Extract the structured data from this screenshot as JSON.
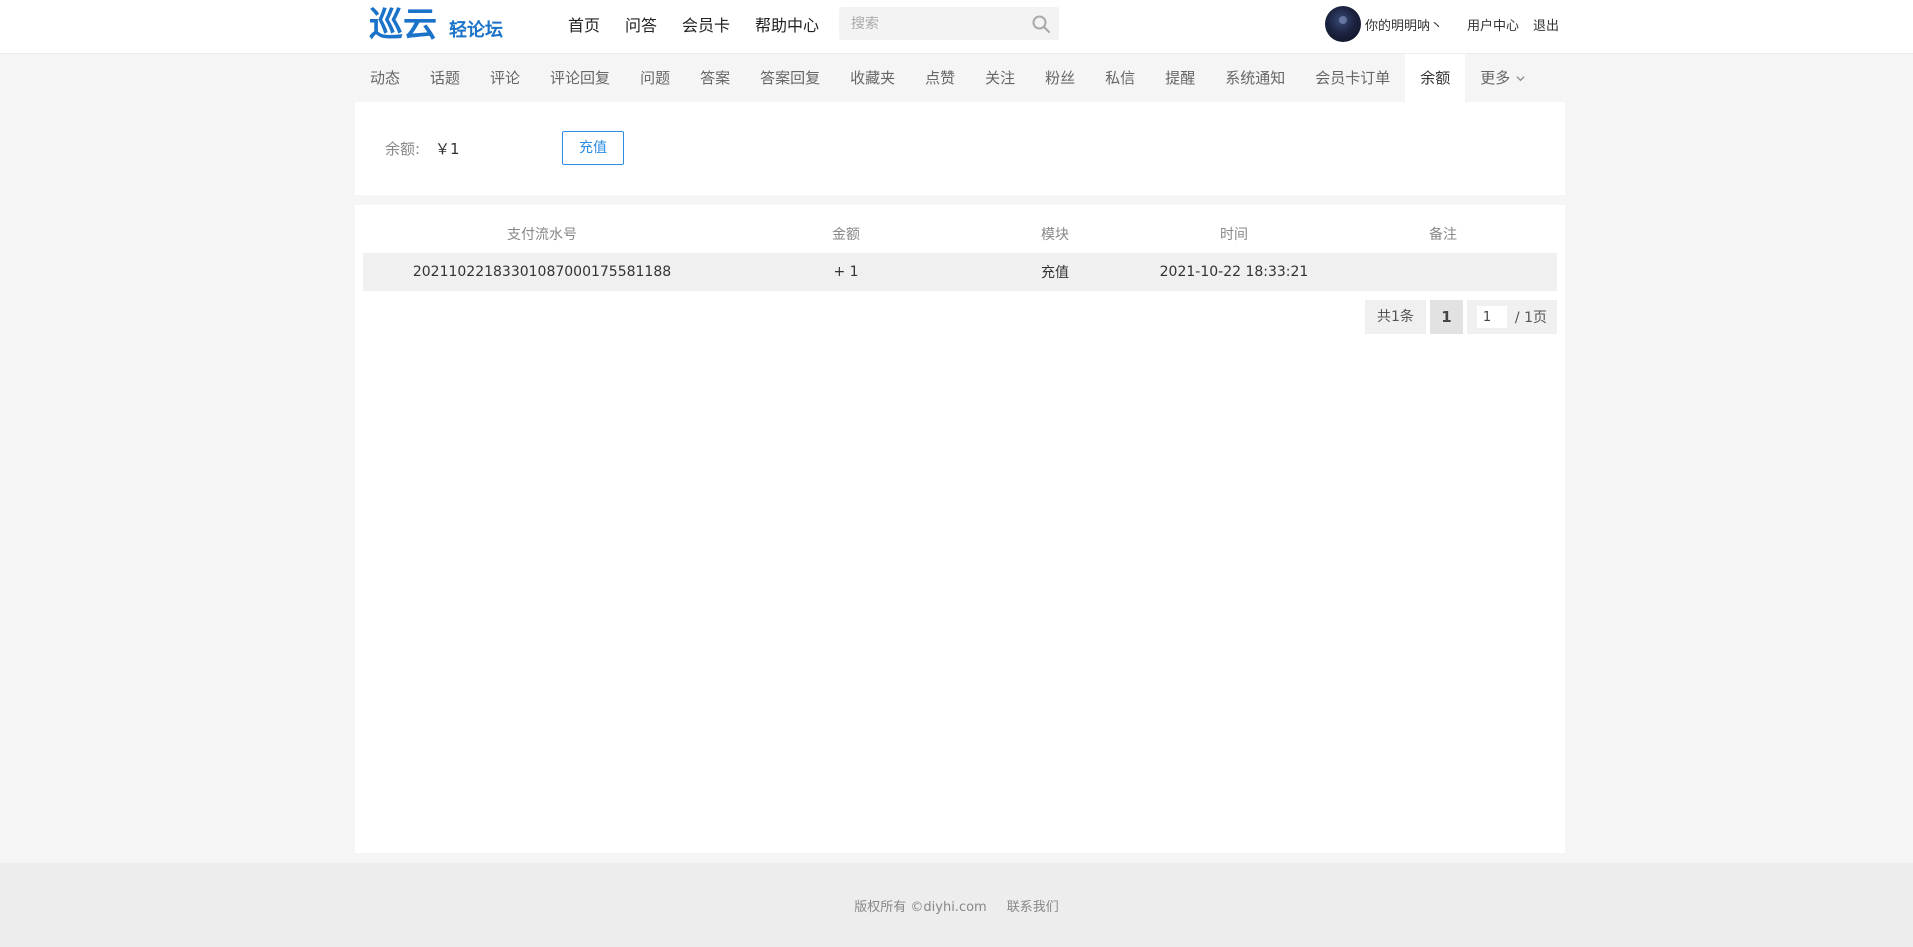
{
  "header": {
    "logo_text": "巡云",
    "logo_sub": "轻论坛",
    "nav": [
      "首页",
      "问答",
      "会员卡",
      "帮助中心"
    ],
    "search_placeholder": "搜索",
    "user_name": "你的明明呐丶",
    "user_center": "用户中心",
    "logout": "退出"
  },
  "tabs": [
    "动态",
    "话题",
    "评论",
    "评论回复",
    "问题",
    "答案",
    "答案回复",
    "收藏夹",
    "点赞",
    "关注",
    "粉丝",
    "私信",
    "提醒",
    "系统通知",
    "会员卡订单",
    "余额"
  ],
  "active_tab": "余额",
  "more_tab": "更多",
  "balance": {
    "label": "余额:",
    "value": "￥1",
    "recharge_button": "充值"
  },
  "table": {
    "headers": [
      "支付流水号",
      "金额",
      "模块",
      "时间",
      "备注"
    ],
    "rows": [
      [
        "20211022183301087000175581188",
        "+ 1",
        "充值",
        "2021-10-22 18:33:21",
        ""
      ]
    ]
  },
  "pager": {
    "total": "共1条",
    "current": "1",
    "input_value": "1",
    "pages": "/ 1页"
  },
  "footer": {
    "copyright": "版权所有 ©diyhi.com",
    "contact": "联系我们"
  },
  "colors": {
    "brand": "#2a8ce4",
    "logo": "#1a73c9"
  }
}
